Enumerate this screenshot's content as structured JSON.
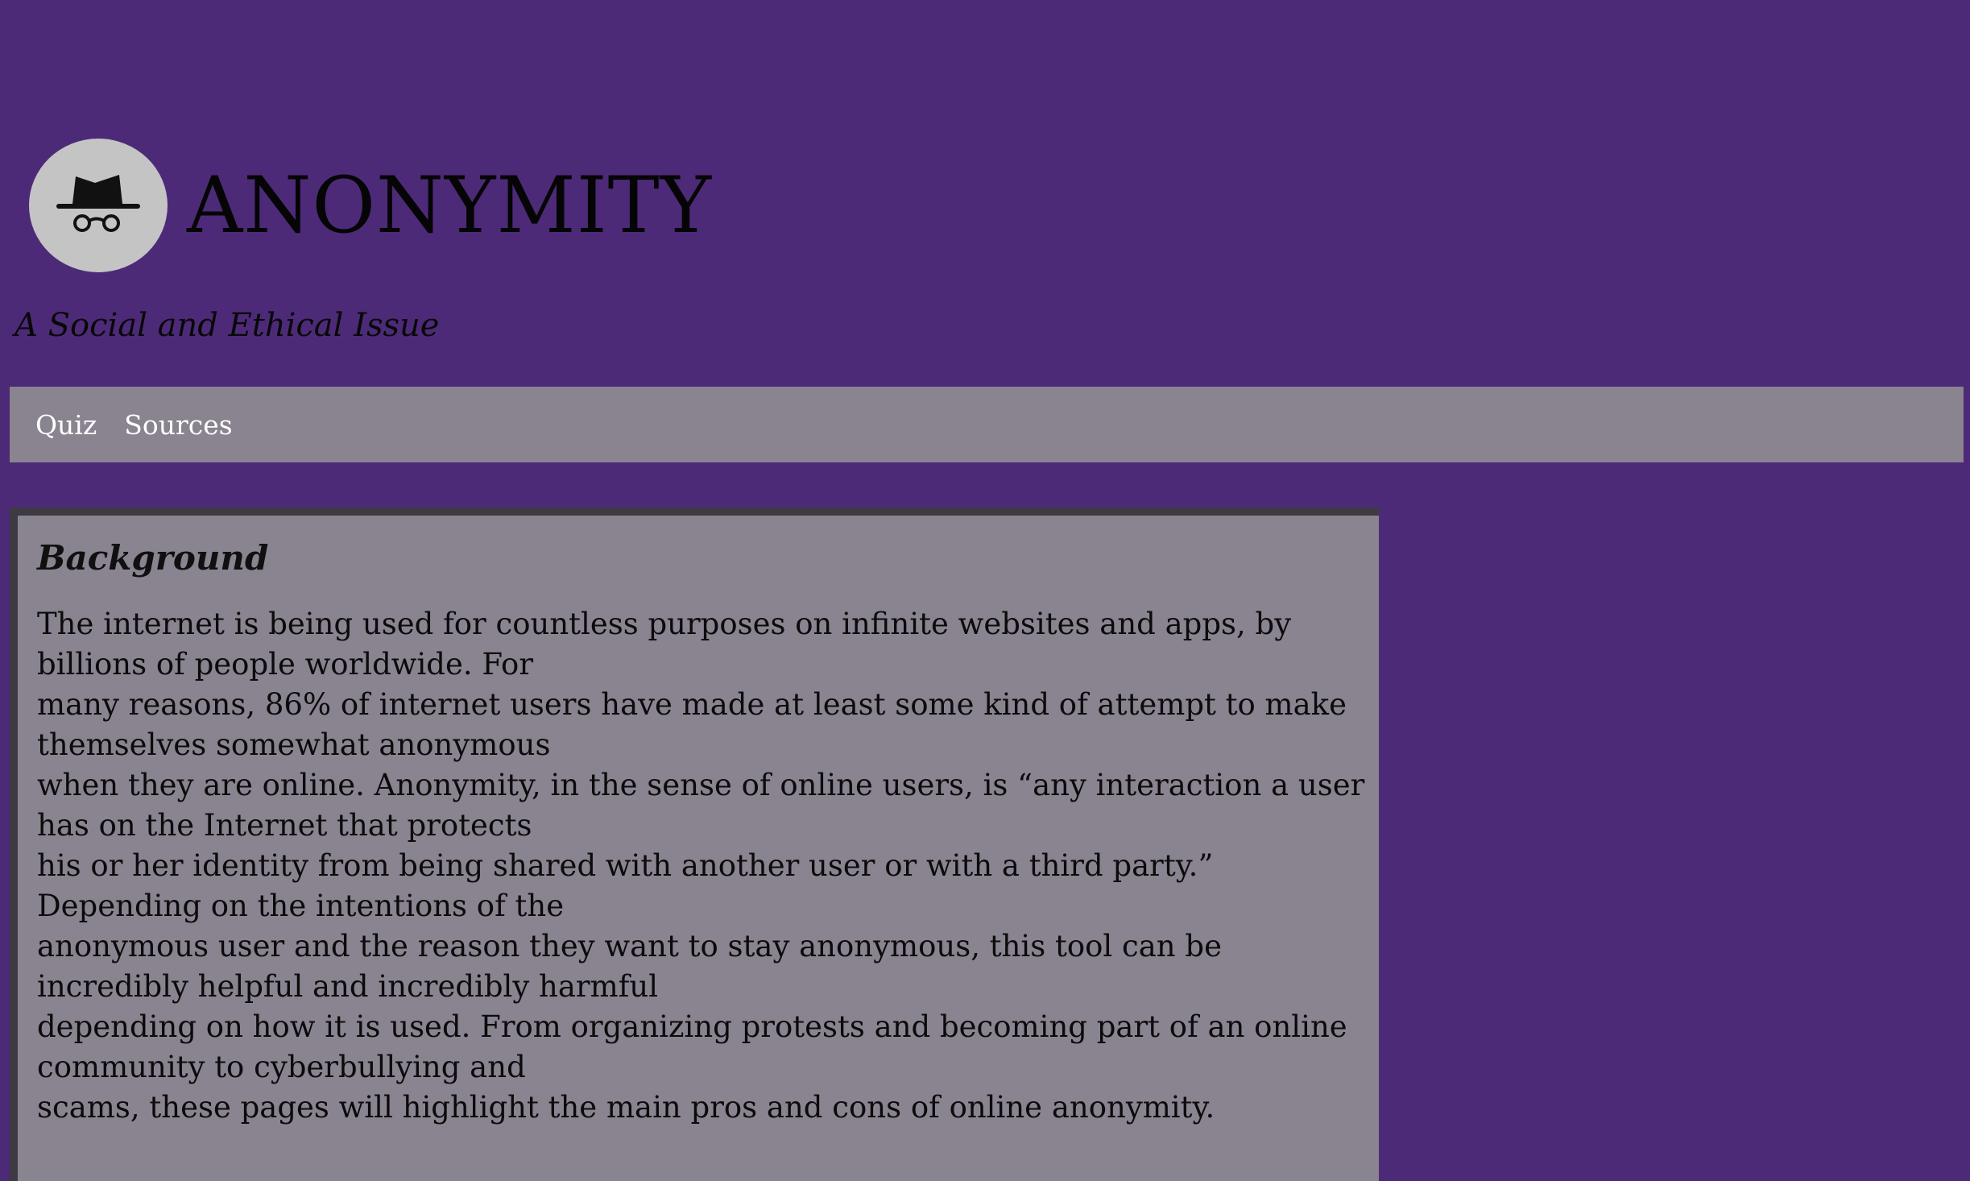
{
  "header": {
    "title": "ANONYMITY",
    "tagline": "A Social and Ethical Issue",
    "logo_icon": "incognito-hat-glasses-icon"
  },
  "nav": {
    "items": [
      {
        "label": "Quiz"
      },
      {
        "label": "Sources"
      }
    ]
  },
  "content": {
    "heading": "Background",
    "lines": [
      "The internet is being used for countless purposes on infinite websites and apps, by",
      "billions of people worldwide. For",
      "many reasons, 86% of internet users have made at least some kind of attempt to make",
      "themselves somewhat anonymous",
      "when they are online. Anonymity, in the sense of online users, is “any interaction a user",
      "has on the Internet that protects",
      "his or her identity from being shared with another user or with a third party.”",
      "Depending on the intentions of the",
      "anonymous user and the reason they want to stay anonymous, this tool can be",
      "incredibly helpful and incredibly harmful",
      "depending on how it is used. From organizing protests and becoming part of an online",
      "community to cyberbullying and",
      "scams, these pages will highlight the main pros and cons of online anonymity."
    ]
  },
  "colors": {
    "page_background": "#4d2a78",
    "panel_gray": "#8a8390",
    "logo_circle": "#c4c4c4",
    "box_border": "#3d3b41",
    "nav_text": "#ffffff"
  }
}
